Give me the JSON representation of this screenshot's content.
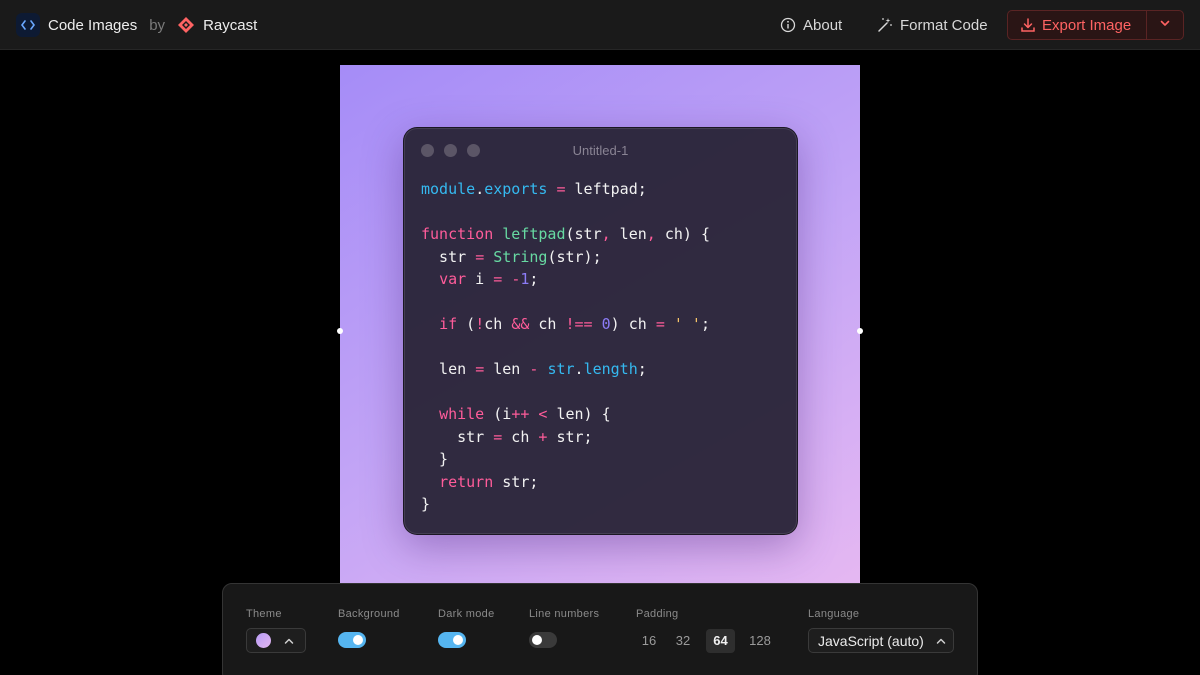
{
  "header": {
    "app_title": "Code Images",
    "by_text": "by",
    "partner_name": "Raycast",
    "about_label": "About",
    "format_label": "Format Code",
    "export_label": "Export Image",
    "accent_color": "#ff6363"
  },
  "icons": {
    "app_logo": "code-brackets-icon",
    "partner_logo": "raycast-logo-icon",
    "about": "info-circle-icon",
    "format": "magic-wand-icon",
    "export": "download-icon",
    "export_menu": "chevron-down-icon"
  },
  "window": {
    "title": "Untitled-1"
  },
  "code_lines": [
    [
      {
        "t": "module",
        "c": "prop"
      },
      {
        "t": ".",
        "c": ""
      },
      {
        "t": "exports",
        "c": "prop"
      },
      {
        "t": " ",
        "c": ""
      },
      {
        "t": "=",
        "c": "op"
      },
      {
        "t": " leftpad;",
        "c": ""
      }
    ],
    [],
    [
      {
        "t": "function",
        "c": "kw"
      },
      {
        "t": " ",
        "c": ""
      },
      {
        "t": "leftpad",
        "c": "fn"
      },
      {
        "t": "(str",
        "c": ""
      },
      {
        "t": ",",
        "c": "op"
      },
      {
        "t": " len",
        "c": ""
      },
      {
        "t": ",",
        "c": "op"
      },
      {
        "t": " ch) {",
        "c": ""
      }
    ],
    [
      {
        "t": "  str ",
        "c": ""
      },
      {
        "t": "=",
        "c": "op"
      },
      {
        "t": " ",
        "c": ""
      },
      {
        "t": "String",
        "c": "fn"
      },
      {
        "t": "(str);",
        "c": ""
      }
    ],
    [
      {
        "t": "  ",
        "c": ""
      },
      {
        "t": "var",
        "c": "kw"
      },
      {
        "t": " i ",
        "c": ""
      },
      {
        "t": "=",
        "c": "op"
      },
      {
        "t": " ",
        "c": ""
      },
      {
        "t": "-",
        "c": "op"
      },
      {
        "t": "1",
        "c": "num"
      },
      {
        "t": ";",
        "c": ""
      }
    ],
    [],
    [
      {
        "t": "  ",
        "c": ""
      },
      {
        "t": "if",
        "c": "kw"
      },
      {
        "t": " (",
        "c": ""
      },
      {
        "t": "!",
        "c": "op"
      },
      {
        "t": "ch ",
        "c": ""
      },
      {
        "t": "&&",
        "c": "op"
      },
      {
        "t": " ch ",
        "c": ""
      },
      {
        "t": "!==",
        "c": "op"
      },
      {
        "t": " ",
        "c": ""
      },
      {
        "t": "0",
        "c": "num"
      },
      {
        "t": ") ch ",
        "c": ""
      },
      {
        "t": "=",
        "c": "op"
      },
      {
        "t": " ",
        "c": ""
      },
      {
        "t": "' '",
        "c": "str"
      },
      {
        "t": ";",
        "c": ""
      }
    ],
    [],
    [
      {
        "t": "  len ",
        "c": ""
      },
      {
        "t": "=",
        "c": "op"
      },
      {
        "t": " len ",
        "c": ""
      },
      {
        "t": "-",
        "c": "op"
      },
      {
        "t": " ",
        "c": ""
      },
      {
        "t": "str",
        "c": "prop"
      },
      {
        "t": ".",
        "c": ""
      },
      {
        "t": "length",
        "c": "prop"
      },
      {
        "t": ";",
        "c": ""
      }
    ],
    [],
    [
      {
        "t": "  ",
        "c": ""
      },
      {
        "t": "while",
        "c": "kw"
      },
      {
        "t": " (i",
        "c": ""
      },
      {
        "t": "++",
        "c": "op"
      },
      {
        "t": " ",
        "c": ""
      },
      {
        "t": "<",
        "c": "op"
      },
      {
        "t": " len) {",
        "c": ""
      }
    ],
    [
      {
        "t": "    str ",
        "c": ""
      },
      {
        "t": "=",
        "c": "op"
      },
      {
        "t": " ch ",
        "c": ""
      },
      {
        "t": "+",
        "c": "op"
      },
      {
        "t": " str;",
        "c": ""
      }
    ],
    [
      {
        "t": "  }",
        "c": ""
      }
    ],
    [
      {
        "t": "  ",
        "c": ""
      },
      {
        "t": "return",
        "c": "kw"
      },
      {
        "t": " str;",
        "c": ""
      }
    ],
    [
      {
        "t": "}",
        "c": ""
      }
    ]
  ],
  "controls": {
    "theme_label": "Theme",
    "background_label": "Background",
    "background_on": true,
    "dark_mode_label": "Dark mode",
    "dark_mode_on": true,
    "line_numbers_label": "Line numbers",
    "line_numbers_on": false,
    "padding_label": "Padding",
    "padding_options": [
      "16",
      "32",
      "64",
      "128"
    ],
    "padding_selected": "64",
    "language_label": "Language",
    "language_value": "JavaScript (auto)"
  }
}
